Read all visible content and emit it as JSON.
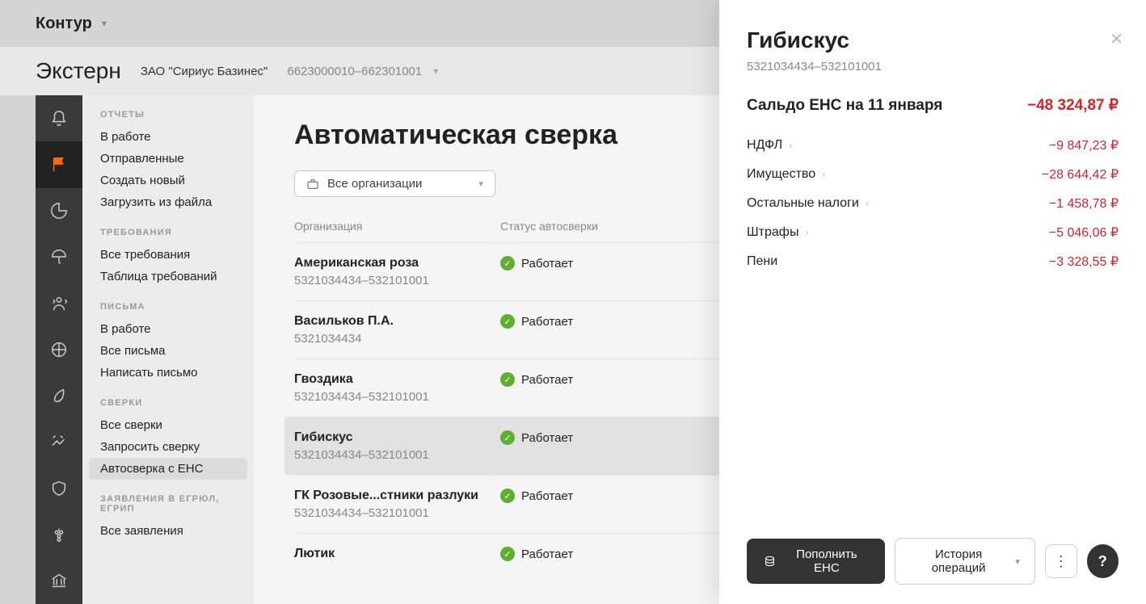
{
  "topbar": {
    "brand": "Контур"
  },
  "subbar": {
    "product": "Экстерн",
    "org_name": "ЗАО \"Сириус Базинес\"",
    "org_id": "6623000010–662301001"
  },
  "sidebar": {
    "groups": [
      {
        "title": "ОТЧЕТЫ",
        "items": [
          {
            "label": "В работе"
          },
          {
            "label": "Отправленные"
          },
          {
            "label": "Создать новый"
          },
          {
            "label": "Загрузить из файла"
          }
        ]
      },
      {
        "title": "ТРЕБОВАНИЯ",
        "items": [
          {
            "label": "Все требования"
          },
          {
            "label": "Таблица требований"
          }
        ]
      },
      {
        "title": "ПИСЬМА",
        "items": [
          {
            "label": "В работе"
          },
          {
            "label": "Все письма"
          },
          {
            "label": "Написать письмо"
          }
        ]
      },
      {
        "title": "СВЕРКИ",
        "items": [
          {
            "label": "Все сверки"
          },
          {
            "label": "Запросить сверку"
          },
          {
            "label": "Автосверка с ЕНС",
            "active": true
          }
        ]
      },
      {
        "title": "ЗАЯВЛЕНИЯ В ЕГРЮЛ, ЕГРИП",
        "items": [
          {
            "label": "Все заявления"
          }
        ]
      }
    ]
  },
  "content": {
    "title": "Автоматическая сверка",
    "filter_label": "Все организации",
    "columns": {
      "org": "Организация",
      "status": "Статус автосверки"
    },
    "status_label": "Работает",
    "rows": [
      {
        "name": "Американская роза",
        "id": "5321034434–532101001"
      },
      {
        "name": "Васильков П.А.",
        "id": "5321034434"
      },
      {
        "name": "Гвоздика",
        "id": "5321034434–532101001"
      },
      {
        "name": "Гибискус",
        "id": "5321034434–532101001",
        "selected": true
      },
      {
        "name": "ГК Розовые...стники разлуки",
        "id": "5321034434–532101001"
      },
      {
        "name": "Лютик",
        "id": ""
      }
    ]
  },
  "panel": {
    "title": "Гибискус",
    "sub": "5321034434–532101001",
    "balance_label": "Сальдо ЕНС на 11 января",
    "balance_value": "−48 324,87 ₽",
    "lines": [
      {
        "label": "НДФЛ",
        "value": "−9 847,23 ₽",
        "chevron": true
      },
      {
        "label": "Имущество",
        "value": "−28 644,42 ₽",
        "chevron": true
      },
      {
        "label": "Остальные налоги",
        "value": "−1 458,78 ₽",
        "chevron": true
      },
      {
        "label": "Штрафы",
        "value": "−5 046,06 ₽",
        "chevron": true
      },
      {
        "label": "Пени",
        "value": "−3 328,55 ₽",
        "chevron": false
      }
    ],
    "actions": {
      "topup": "Пополнить ЕНС",
      "history": "История операций",
      "help": "?"
    }
  }
}
